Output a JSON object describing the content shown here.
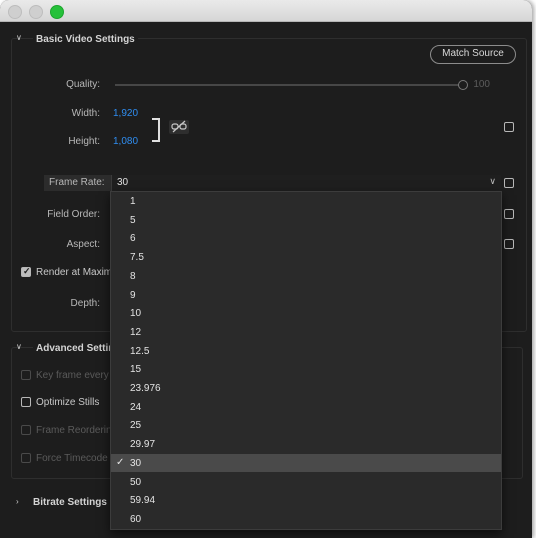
{
  "basic": {
    "title": "Basic Video Settings",
    "match_source": "Match Source",
    "quality_label": "Quality:",
    "quality_value": "100",
    "width_label": "Width:",
    "width_value": "1,920",
    "height_label": "Height:",
    "height_value": "1,080",
    "frame_rate_label": "Frame Rate:",
    "frame_rate_value": "30",
    "field_order_label": "Field Order:",
    "aspect_label": "Aspect:",
    "render_max_label": "Render at Maximu",
    "depth_label": "Depth:"
  },
  "advanced": {
    "title": "Advanced Setting",
    "key_frame_label": "Key frame every",
    "optimize_stills_label": "Optimize Stills",
    "frame_reordering_label": "Frame Reordering",
    "force_timecode_label": "Force Timecode (i"
  },
  "bitrate": {
    "title": "Bitrate Settings"
  },
  "dropdown": {
    "options": [
      "1",
      "5",
      "6",
      "7.5",
      "8",
      "9",
      "10",
      "12",
      "12.5",
      "15",
      "23.976",
      "24",
      "25",
      "29.97",
      "30",
      "50",
      "59.94",
      "60"
    ],
    "selected": "30"
  },
  "colors": {
    "accent": "#2f8df0",
    "background": "#1d1d1d",
    "zoom": "#26c13a"
  }
}
